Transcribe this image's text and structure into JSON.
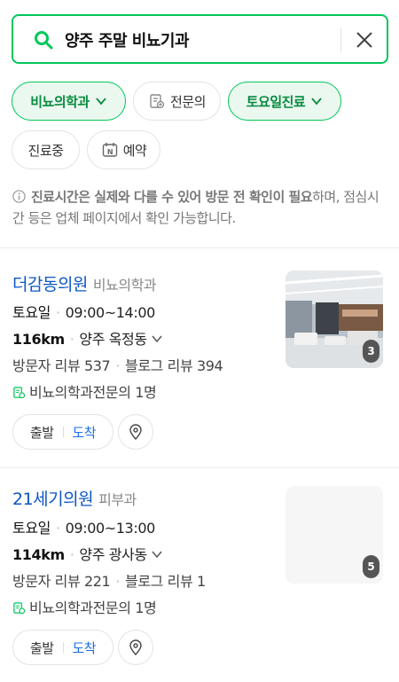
{
  "search": {
    "query": "양주 주말 비뇨기과"
  },
  "filters": [
    {
      "label": "비뇨의학과",
      "active": true,
      "chevron": true,
      "icon": ""
    },
    {
      "label": "전문의",
      "active": false,
      "chevron": false,
      "icon": "specialist-icon"
    },
    {
      "label": "토요일진료",
      "active": true,
      "chevron": true,
      "icon": ""
    },
    {
      "label": "진료중",
      "active": false,
      "chevron": false,
      "icon": ""
    },
    {
      "label": "예약",
      "active": false,
      "chevron": false,
      "icon": "naver-booking-icon"
    }
  ],
  "notice": {
    "bold": "진료시간은 실제와 다를 수 있어 방문 전 확인이 필요",
    "rest": "하며, 점심시간 등은 업체 페이지에서 확인 가능합니다."
  },
  "results": [
    {
      "name": "더감동의원",
      "category": "비뇨의학과",
      "day": "토요일",
      "hours": "09:00~14:00",
      "distance": "116km",
      "location": "양주 옥정동",
      "visitor_reviews": "방문자 리뷰 537",
      "blog_reviews": "블로그 리뷰 394",
      "specialist": "비뇨의학과전문의 1명",
      "photo_count": "3",
      "depart_label": "출발",
      "arrive_label": "도착"
    },
    {
      "name": "21세기의원",
      "category": "피부과",
      "day": "토요일",
      "hours": "09:00~13:00",
      "distance": "114km",
      "location": "양주 광사동",
      "visitor_reviews": "방문자 리뷰 221",
      "blog_reviews": "블로그 리뷰 1",
      "specialist": "비뇨의학과전문의 1명",
      "photo_count": "5",
      "depart_label": "출발",
      "arrive_label": "도착"
    }
  ],
  "colors": {
    "accent": "#03c75a",
    "link": "#0b56c5",
    "arrive": "#1a6fe8"
  }
}
